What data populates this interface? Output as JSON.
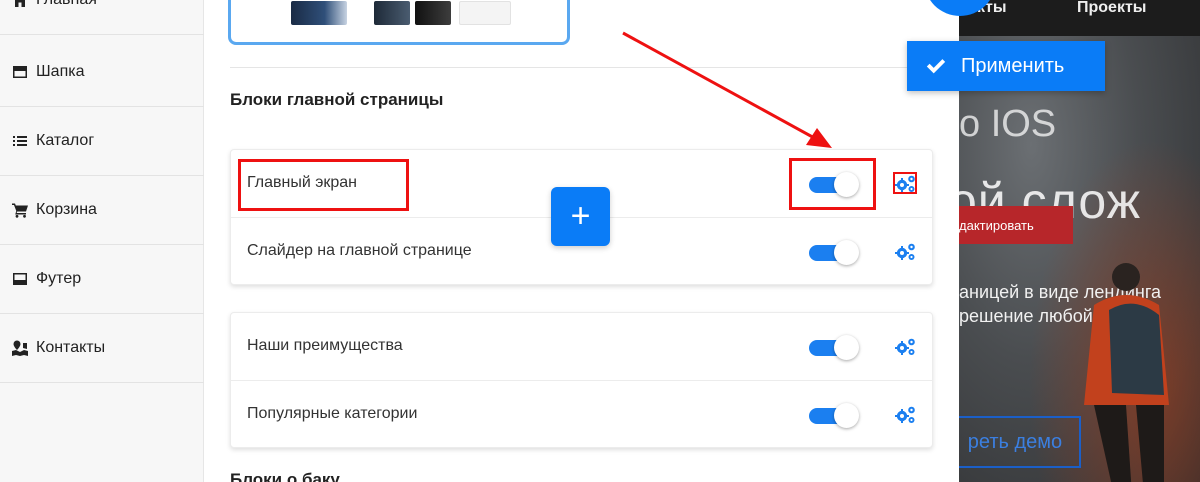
{
  "sidebar": {
    "items": [
      {
        "label": "Главная",
        "icon": "home-icon"
      },
      {
        "label": "Шапка",
        "icon": "header-icon"
      },
      {
        "label": "Каталог",
        "icon": "list-icon"
      },
      {
        "label": "Корзина",
        "icon": "cart-icon"
      },
      {
        "label": "Футер",
        "icon": "footer-icon"
      },
      {
        "label": "Контакты",
        "icon": "map-icon"
      }
    ]
  },
  "main": {
    "section_title": "Блоки главной страницы",
    "section_title_2": "Блоки о баку",
    "cards": [
      {
        "rows": [
          {
            "label": "Главный экран",
            "enabled": true
          },
          {
            "label": "Слайдер на главной странице",
            "enabled": true
          }
        ]
      },
      {
        "rows": [
          {
            "label": "Наши преимущества",
            "enabled": true
          },
          {
            "label": "Популярные категории",
            "enabled": true
          }
        ]
      }
    ],
    "add_button_label": "+"
  },
  "apply_button": {
    "label": "Применить"
  },
  "site_preview": {
    "nav": [
      "кты",
      "Проекты"
    ],
    "heading_1": "o IOS",
    "heading_2": "ой слож",
    "edit_button": "дактировать",
    "text_1": "аницей в виде лендинга",
    "text_2": "решение любой сферы",
    "demo_button": "реть демо"
  },
  "colors": {
    "accent": "#0a7cf7",
    "annotation": "#ee1111",
    "toggle_on": "#1b7ff0"
  }
}
